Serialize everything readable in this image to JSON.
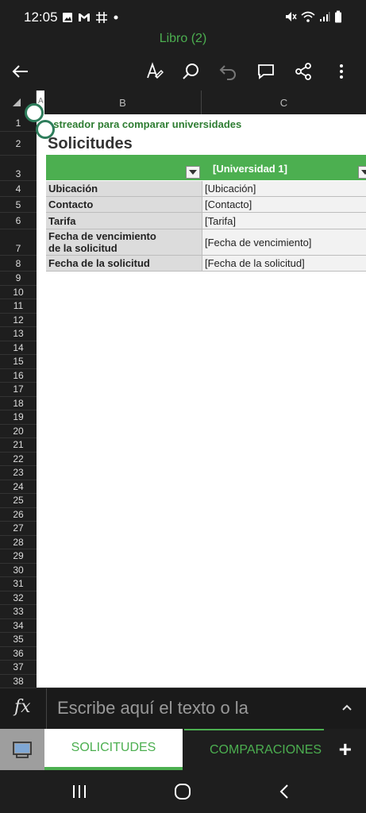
{
  "status": {
    "time": "12:05"
  },
  "app": {
    "title": "Libro (2)"
  },
  "columns": [
    "B",
    "C"
  ],
  "corner_col": "A",
  "rows": [
    "1",
    "2",
    "3",
    "4",
    "5",
    "6",
    "7",
    "8",
    "9",
    "10",
    "11",
    "12",
    "13",
    "14",
    "15",
    "16",
    "17",
    "18",
    "19",
    "20",
    "21",
    "22",
    "23",
    "24",
    "25",
    "26",
    "27",
    "28",
    "29",
    "30",
    "31",
    "32",
    "33",
    "34",
    "35",
    "36",
    "37",
    "38"
  ],
  "sheet": {
    "subtitle": "astreador para comparar universidades",
    "title": "Solicitudes",
    "header_value": "[Universidad 1]",
    "table": [
      {
        "label": "Ubicación",
        "value": "[Ubicación]"
      },
      {
        "label": "Contacto",
        "value": "[Contacto]"
      },
      {
        "label": "Tarifa",
        "value": "[Tarifa]"
      },
      {
        "label": "Fecha de vencimiento\nde la solicitud",
        "value": "[Fecha de vencimiento]"
      },
      {
        "label": "Fecha de la solicitud",
        "value": "[Fecha de la solicitud]"
      }
    ]
  },
  "formula": {
    "fx": "fx",
    "placeholder": "Escribe aquí el texto o la"
  },
  "tabs": [
    {
      "label": "SOLICITUDES",
      "active": true
    },
    {
      "label": "COMPARACIONES",
      "active": false
    }
  ],
  "add_sheet": "+",
  "colors": {
    "accent": "#4caf50",
    "dark": "#1e1e1e"
  }
}
